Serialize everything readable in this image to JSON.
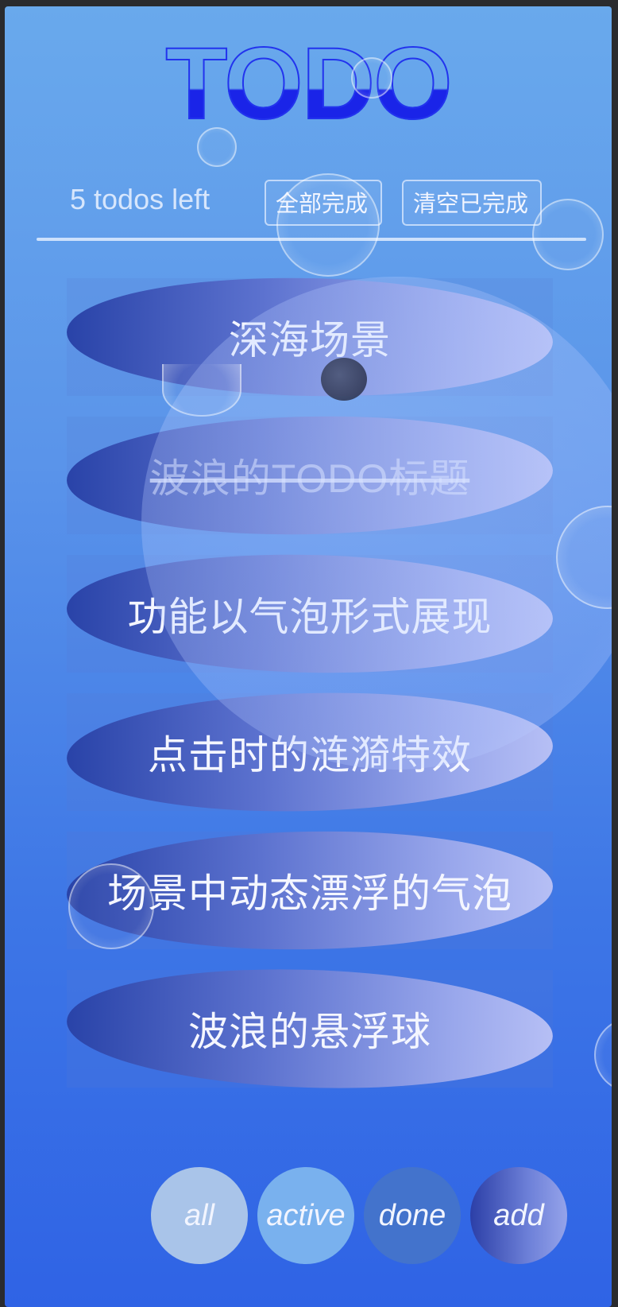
{
  "app": {
    "title": "TODO",
    "todos_left": "5 todos left",
    "complete_all_label": "全部完成",
    "clear_completed_label": "清空已完成"
  },
  "todos": [
    {
      "text": "深海场景",
      "completed": false
    },
    {
      "text": "波浪的TODO标题",
      "completed": true
    },
    {
      "text": "功能以气泡形式展现",
      "completed": false
    },
    {
      "text": "点击时的涟漪特效",
      "completed": false
    },
    {
      "text": "场景中动态漂浮的气泡",
      "completed": false
    },
    {
      "text": "波浪的悬浮球",
      "completed": false
    }
  ],
  "filters": [
    {
      "label": "all",
      "active": true
    },
    {
      "label": "active",
      "active": false
    },
    {
      "label": "done",
      "active": false
    },
    {
      "label": "add",
      "active": false
    }
  ],
  "colors": {
    "background_top": "#69a9ec",
    "background_bottom": "#2f63e5",
    "title": "#1a24e8"
  }
}
